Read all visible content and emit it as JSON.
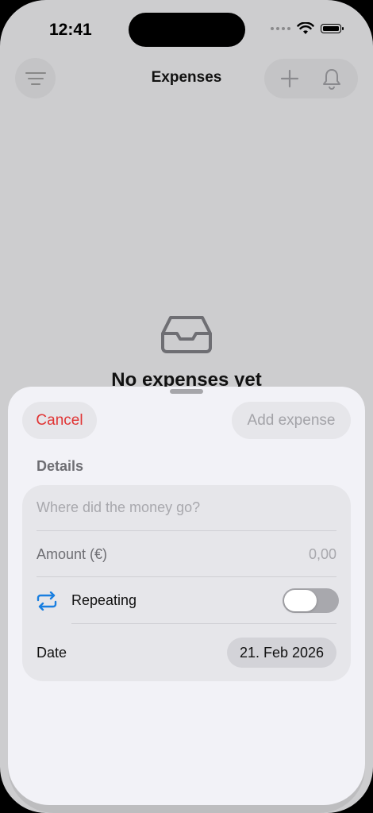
{
  "status_bar": {
    "time": "12:41"
  },
  "nav": {
    "title": "Expenses"
  },
  "empty_state": {
    "message": "No expenses yet"
  },
  "sheet": {
    "cancel_label": "Cancel",
    "add_label": "Add expense",
    "section_title": "Details",
    "description_placeholder": "Where did the money go?",
    "amount_label": "Amount (€)",
    "amount_value": "0,00",
    "repeating_label": "Repeating",
    "repeating_on": false,
    "date_label": "Date",
    "date_value": "21. Feb 2026"
  },
  "colors": {
    "cancel": "#e03434",
    "accent": "#1a7fe0",
    "disabled": "#a3a3a8"
  },
  "icons": [
    "menu-icon",
    "plus-icon",
    "bell-icon",
    "inbox-tray-icon",
    "repeat-icon",
    "wifi-icon",
    "battery-icon"
  ]
}
